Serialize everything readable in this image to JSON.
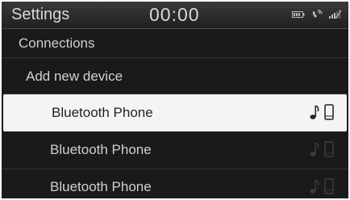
{
  "header": {
    "title": "Settings",
    "clock": "00:00"
  },
  "menu": {
    "connections_label": "Connections",
    "add_device_label": "Add new device"
  },
  "devices": [
    {
      "label": "Bluetooth Phone",
      "selected": true
    },
    {
      "label": "Bluetooth Phone",
      "selected": false
    },
    {
      "label": "Bluetooth Phone",
      "selected": false
    }
  ],
  "status_icons": [
    "battery-icon",
    "phone-call-icon",
    "signal-icon"
  ],
  "device_icons": [
    "music-note-icon",
    "phone-icon"
  ],
  "colors": {
    "screen_bg": "#1a1a1a",
    "selected_row_bg": "#f4f4f4",
    "text_light": "#d0d0d0",
    "text_dark": "#222222"
  }
}
